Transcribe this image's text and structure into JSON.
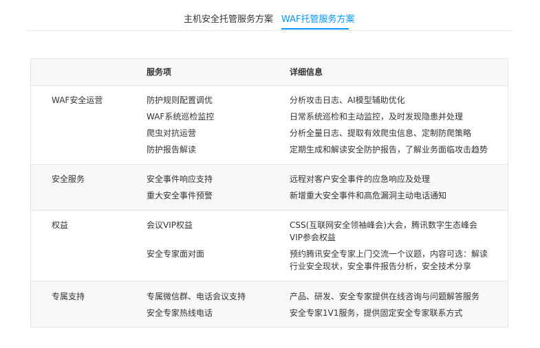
{
  "tabs": [
    {
      "label": "主机安全托管服务方案",
      "active": false
    },
    {
      "label": "WAF托管服务方案",
      "active": true
    }
  ],
  "accent_color": "#0096ff",
  "table": {
    "headers": [
      "",
      "服务项",
      "详细信息"
    ],
    "groups": [
      {
        "category": "WAF安全运营",
        "rows": [
          {
            "service": "防护规则配置调优",
            "detail": [
              "分析攻击日志、AI模型辅助优化"
            ]
          },
          {
            "service": "WAF系统巡检监控",
            "detail": [
              "日常系统巡检和主动监控，及时发现隐患并处理"
            ]
          },
          {
            "service": "爬虫对抗运营",
            "detail": [
              "分析全量日志、提取有效爬虫信息、定制防爬策略"
            ]
          },
          {
            "service": "防护报告解读",
            "detail": [
              "定期生成和解读安全防护报告，了解业务面临攻击趋势"
            ]
          }
        ]
      },
      {
        "category": "安全服务",
        "rows": [
          {
            "service": "安全事件响应支持",
            "detail": [
              "远程对客户安全事件的应急响应及处理"
            ]
          },
          {
            "service": "重大安全事件预警",
            "detail": [
              "新增重大安全事件和高危漏洞主动电话通知"
            ]
          }
        ]
      },
      {
        "category": "权益",
        "rows": [
          {
            "service": "会议VIP权益",
            "detail": [
              "CSS(互联网安全领袖峰会)大会，腾讯数字生态峰会",
              "VIP参会权益"
            ]
          },
          {
            "service": "安全专家面对面",
            "detail": [
              "预约腾讯安全专家上门交流一个议题，内容可选：解读",
              "行业安全现状，安全事件报告分析，安全技术分享"
            ]
          }
        ]
      },
      {
        "category": "专属支持",
        "rows": [
          {
            "service": "专属微信群、电话会议支持",
            "detail": [
              "产品、研发、安全专家提供在线咨询与问题解答服务"
            ]
          },
          {
            "service": "安全专家热线电话",
            "detail": [
              "安全专家1V1服务，提供固定安全专家联系方式"
            ]
          }
        ]
      }
    ]
  }
}
